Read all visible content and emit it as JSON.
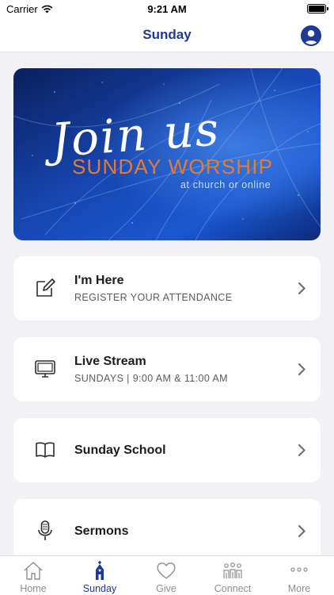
{
  "status_bar": {
    "carrier": "Carrier",
    "time": "9:21 AM"
  },
  "nav": {
    "title": "Sunday"
  },
  "hero": {
    "script_text": "Join us",
    "headline": "SUNDAY WORSHIP",
    "subline": "at church or online"
  },
  "cards": [
    {
      "title": "I'm Here",
      "subtitle": "REGISTER YOUR ATTENDANCE",
      "icon": "edit-icon"
    },
    {
      "title": "Live Stream",
      "subtitle": "SUNDAYS | 9:00 AM & 11:00 AM",
      "icon": "monitor-icon"
    },
    {
      "title": "Sunday School",
      "subtitle": "",
      "icon": "book-icon"
    },
    {
      "title": "Sermons",
      "subtitle": "",
      "icon": "microphone-icon"
    }
  ],
  "tabs": [
    {
      "label": "Home",
      "icon": "house-icon"
    },
    {
      "label": "Sunday",
      "icon": "church-icon"
    },
    {
      "label": "Give",
      "icon": "heart-icon"
    },
    {
      "label": "Connect",
      "icon": "people-icon"
    },
    {
      "label": "More",
      "icon": "ellipsis-icon"
    }
  ],
  "colors": {
    "accent": "#1f3a93",
    "tab_inactive": "#8e8e93",
    "headline": "#e57b2c",
    "background": "#f2f2f6"
  }
}
